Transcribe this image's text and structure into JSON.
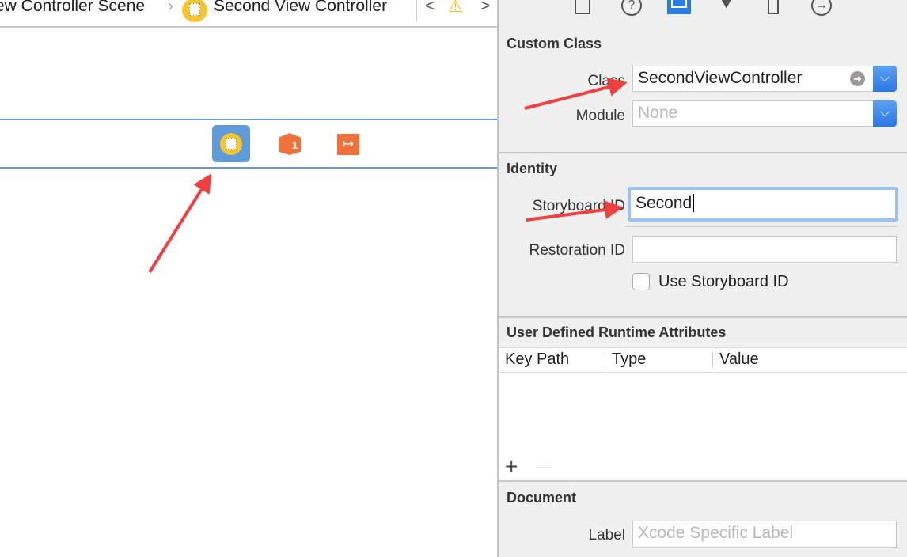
{
  "jumpbar": {
    "crumb1": "ew Controller Scene",
    "crumb2": "Second View Controller",
    "separator": "›",
    "back": "<",
    "forward": ">",
    "warning": "⚠"
  },
  "toolbar": {
    "icons": [
      "file-inspector-icon",
      "quick-help-icon",
      "identity-inspector-icon",
      "attributes-inspector-icon",
      "size-inspector-icon",
      "connections-inspector-icon"
    ],
    "selected": "identity-inspector-icon",
    "accent": "#2a7de1"
  },
  "custom_class": {
    "title": "Custom Class",
    "class_label": "Class",
    "class_value": "SecondViewController",
    "module_label": "Module",
    "module_placeholder": "None"
  },
  "identity": {
    "title": "Identity",
    "storyboard_id_label": "Storyboard ID",
    "storyboard_id_value": "Second",
    "restoration_id_label": "Restoration ID",
    "restoration_id_value": "",
    "use_storyboard_id_label": "Use Storyboard ID",
    "use_storyboard_id_checked": false
  },
  "runtime": {
    "title": "User Defined Runtime Attributes",
    "columns": [
      "Key Path",
      "Type",
      "Value"
    ],
    "add": "+",
    "remove": "—"
  },
  "document": {
    "title": "Document",
    "label_label": "Label",
    "label_placeholder": "Xcode Specific Label"
  },
  "colors": {
    "annotation_arrow": "#f04040",
    "dock_line": "#6a9bd0"
  }
}
